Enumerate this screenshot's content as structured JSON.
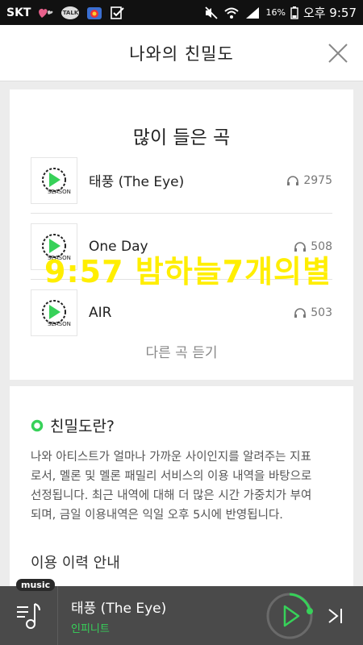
{
  "statusbar": {
    "carrier": "SKT",
    "talk": "TALK",
    "battery": "16%",
    "time": "오후 9:57"
  },
  "header": {
    "title": "나와의 친밀도"
  },
  "songs": {
    "title": "많이 들은 곡",
    "items": [
      {
        "title": "태풍 (The Eye)",
        "count": "2975"
      },
      {
        "title": "One Day",
        "count": "508"
      },
      {
        "title": "AIR",
        "count": "503"
      }
    ],
    "more_label": "다른 곡 듣기"
  },
  "info": {
    "heading": "친밀도란?",
    "body": "나와 아티스트가 얼마나 가까운 사이인지를 알려주는 지표로서, 멜론 및 멜론 패밀리 서비스의 이용 내역을 바탕으로 선정됩니다. 최근 내역에 대해 더 많은 시간 가중치가 부여되며, 금일 이용내역은 익일 오후 5시에 반영됩니다.",
    "subheading": "이용 이력 안내"
  },
  "watermark": "9:57 밤하늘7개의별",
  "player": {
    "tag": "music",
    "title": "태풍 (The Eye)",
    "artist": "인피니트"
  },
  "colors": {
    "accent": "#37d159",
    "watermark": "#ffee00"
  }
}
